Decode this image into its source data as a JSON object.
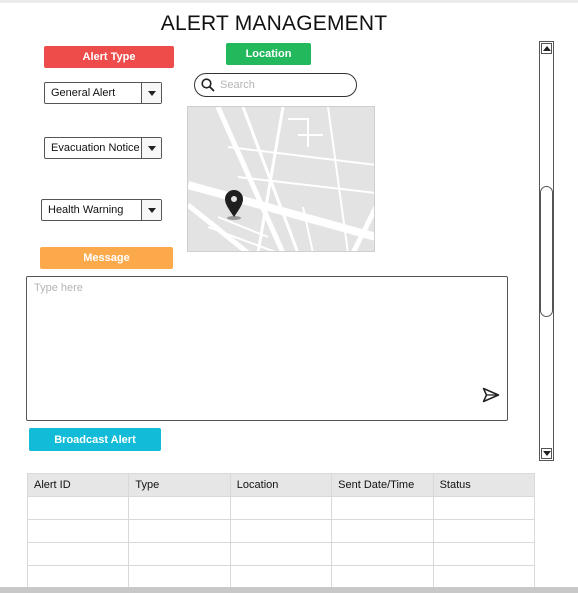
{
  "page": {
    "title": "ALERT MANAGEMENT"
  },
  "labels": {
    "alert_type": "Alert Type",
    "location": "Location",
    "message": "Message",
    "broadcast": "Broadcast Alert"
  },
  "alert_types": [
    "General Alert",
    "Evacuation Notice",
    "Health Warning"
  ],
  "search": {
    "placeholder": "Search",
    "value": ""
  },
  "map": {
    "marker": "map-pin-icon"
  },
  "message_box": {
    "placeholder": "Type here",
    "send_icon": "send-icon"
  },
  "table": {
    "columns": [
      "Alert ID",
      "Type",
      "Location",
      "Sent Date/Time",
      "Status"
    ],
    "rows": [
      [
        "",
        "",
        "",
        "",
        ""
      ],
      [
        "",
        "",
        "",
        "",
        ""
      ],
      [
        "",
        "",
        "",
        "",
        ""
      ],
      [
        "",
        "",
        "",
        "",
        ""
      ]
    ]
  },
  "colors": {
    "alert_type": "#ee4b4b",
    "location": "#22b85c",
    "message": "#fba94a",
    "broadcast": "#12bcd9"
  }
}
